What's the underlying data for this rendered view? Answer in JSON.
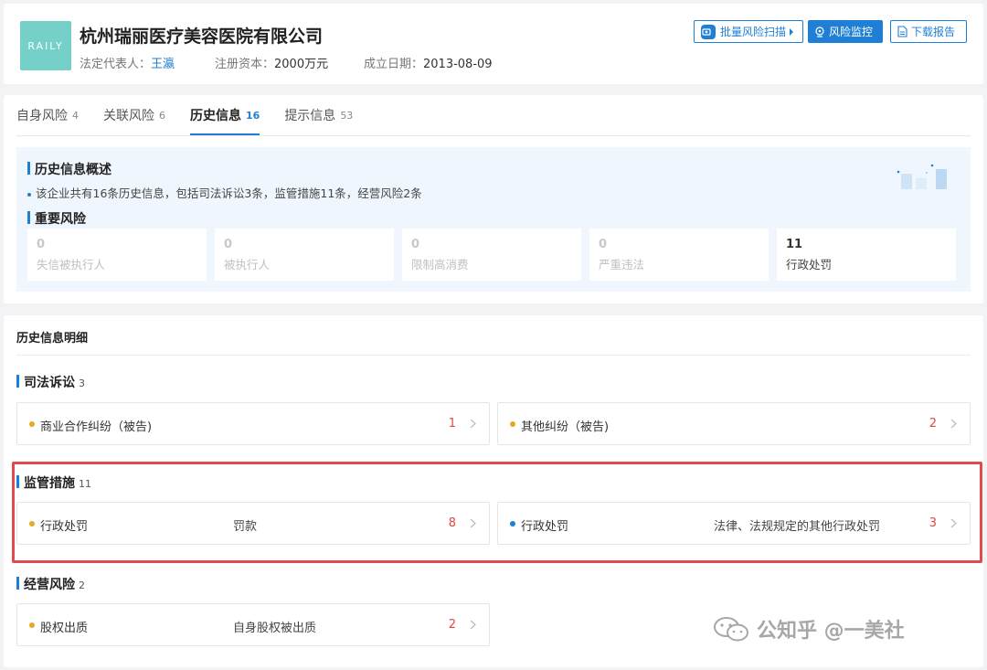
{
  "company": {
    "logo_text": "RAILY",
    "name": "杭州瑞丽医疗美容医院有限公司",
    "legal_rep_label": "法定代表人：",
    "legal_rep": "王瀛",
    "capital_label": "注册资本：",
    "capital": "2000万元",
    "founded_label": "成立日期：",
    "founded": "2013-08-09"
  },
  "actions": {
    "batch_scan": "批量风险扫描",
    "monitor": "风险监控",
    "download": "下载报告"
  },
  "tabs": [
    {
      "label": "自身风险",
      "count": "4"
    },
    {
      "label": "关联风险",
      "count": "6"
    },
    {
      "label": "历史信息",
      "count": "16"
    },
    {
      "label": "提示信息",
      "count": "53"
    }
  ],
  "overview": {
    "title": "历史信息概述",
    "summary": "该企业共有16条历史信息，包括司法诉讼3条，监管措施11条，经营风险2条",
    "risk_title": "重要风险",
    "risks": [
      {
        "value": "0",
        "label": "失信被执行人"
      },
      {
        "value": "0",
        "label": "被执行人"
      },
      {
        "value": "0",
        "label": "限制高消费"
      },
      {
        "value": "0",
        "label": "严重违法"
      },
      {
        "value": "11",
        "label": "行政处罚"
      }
    ]
  },
  "details": {
    "title": "历史信息明细",
    "sections": [
      {
        "title": "司法诉讼",
        "count": "3",
        "items": [
          {
            "name": "商业合作纠纷（被告)",
            "desc": "",
            "count": "1"
          },
          {
            "name": "其他纠纷（被告)",
            "desc": "",
            "count": "2"
          }
        ]
      },
      {
        "title": "监管措施",
        "count": "11",
        "items": [
          {
            "name": "行政处罚",
            "desc": "罚款",
            "count": "8"
          },
          {
            "name": "行政处罚",
            "desc": "法律、法规规定的其他行政处罚",
            "count": "3"
          }
        ]
      },
      {
        "title": "经营风险",
        "count": "2",
        "items": [
          {
            "name": "股权出质",
            "desc": "自身股权被出质",
            "count": "2"
          }
        ]
      }
    ]
  },
  "watermark": "公知乎 @一美社",
  "colors": {
    "accent": "#1f7fd4",
    "danger": "#e04747",
    "highlight": "#e04c4c",
    "logo_bg": "#74d0c9"
  }
}
